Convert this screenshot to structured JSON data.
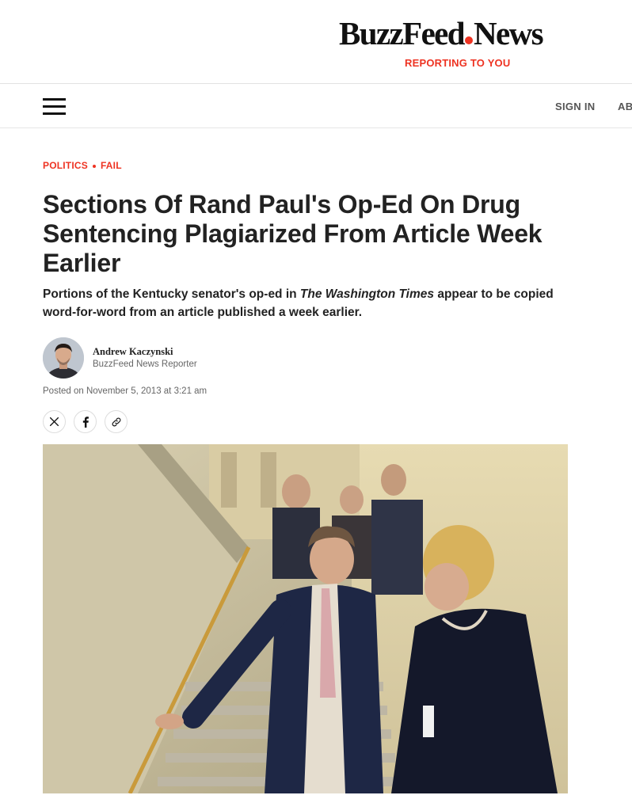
{
  "brand": {
    "logo_part1": "BuzzFeed",
    "logo_part2": "News",
    "tagline": "REPORTING TO YOU",
    "accent_color": "#e32222"
  },
  "nav": {
    "menu_icon": "hamburger-menu-icon",
    "sign_in": "SIGN IN",
    "about": "AB"
  },
  "article": {
    "category": "POLITICS",
    "subcategory": "FAIL",
    "headline": "Sections Of Rand Paul's Op-Ed On Drug Sentencing Plagiarized From Article Week Earlier",
    "dek_before": "Portions of the Kentucky senator's op-ed in ",
    "dek_italic": "The Washington Times",
    "dek_after": " appear to be copied word-for-word from an article published a week earlier.",
    "author_name": "Andrew Kaczynski",
    "author_role": "BuzzFeed News Reporter",
    "posted": "Posted on November 5, 2013 at 3:21 am"
  },
  "share": {
    "icons": [
      "x-twitter-icon",
      "facebook-icon",
      "link-icon"
    ]
  }
}
